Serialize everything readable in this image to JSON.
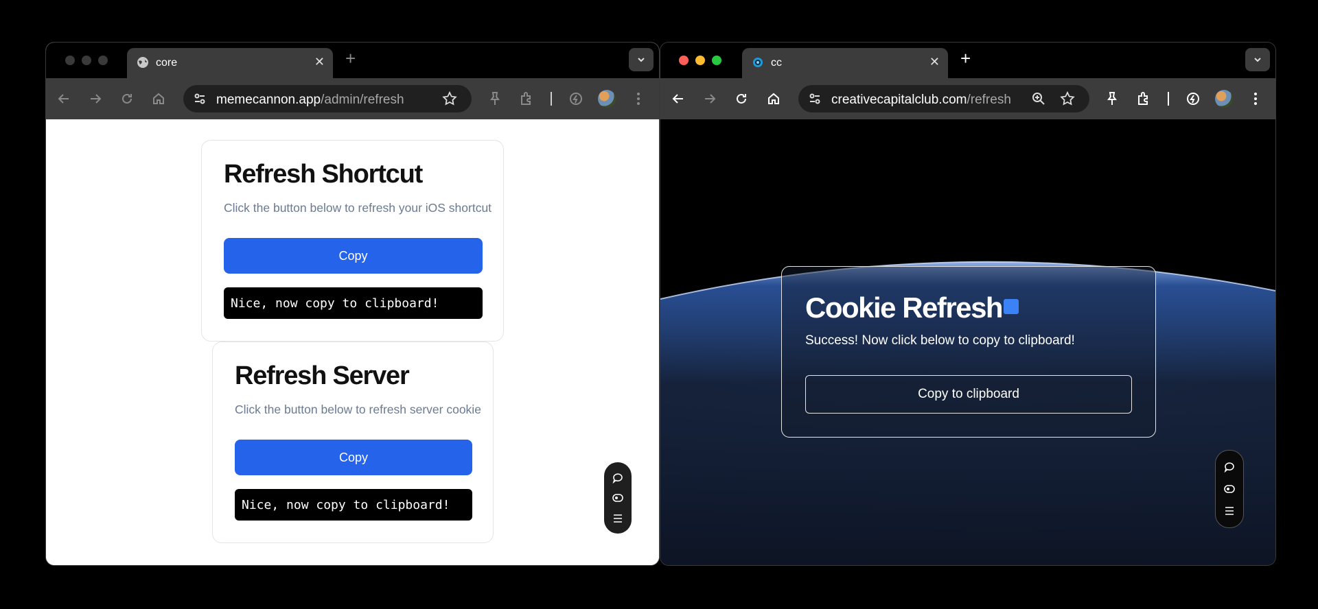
{
  "left_window": {
    "tab": {
      "title": "core"
    },
    "toolbar": {
      "url_host": "memecannon.app",
      "url_path": "/admin/refresh"
    },
    "page": {
      "cards": [
        {
          "title": "Refresh Shortcut",
          "subtitle": "Click the button below to refresh your iOS shortcut",
          "button_label": "Copy",
          "code_text": "Nice, now copy to clipboard!"
        },
        {
          "title": "Refresh Server",
          "subtitle": "Click the button below to refresh server cookie",
          "button_label": "Copy",
          "code_text": "Nice, now copy to clipboard!"
        }
      ]
    }
  },
  "right_window": {
    "tab": {
      "title": "cc"
    },
    "toolbar": {
      "url_host": "creativecapitalclub.com",
      "url_path": "/refresh"
    },
    "page": {
      "title": "Cookie Refresh",
      "subtitle": "Success! Now click below to copy to clipboard!",
      "button_label": "Copy to clipboard"
    }
  },
  "colors": {
    "primary_button": "#2563eb",
    "code_box": "#000000",
    "status_square": "#3b82f6",
    "traffic_light_close": "#ff5f57",
    "traffic_light_minimize": "#febc2e",
    "traffic_light_zoom": "#28c840"
  },
  "icons": {
    "floating_toolbar": [
      "chat-bubble-icon",
      "eye-icon",
      "menu-icon"
    ],
    "browser_toolbar": [
      "back-arrow-icon",
      "forward-arrow-icon",
      "reload-icon",
      "home-icon",
      "site-info-icon",
      "zoom-icon",
      "star-icon",
      "pin-icon",
      "extensions-icon",
      "performance-icon",
      "avatar",
      "kebab-menu-icon"
    ]
  }
}
